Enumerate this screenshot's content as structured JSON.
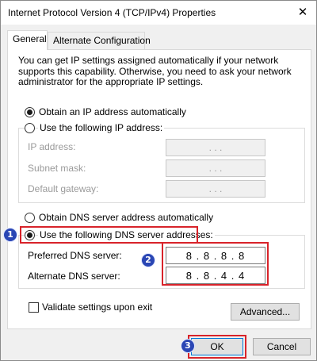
{
  "window": {
    "title": "Internet Protocol Version 4 (TCP/IPv4) Properties",
    "close_glyph": "✕"
  },
  "tabs": [
    {
      "label": "General"
    },
    {
      "label": "Alternate Configuration"
    }
  ],
  "info_text": "You can get IP settings assigned automatically if your network supports this capability. Otherwise, you need to ask your network administrator for the appropriate IP settings.",
  "ip_section": {
    "obtain_auto_label": "Obtain an IP address automatically",
    "use_following_label": "Use the following IP address:",
    "fields": [
      {
        "label": "IP address:",
        "value": ".    .    ."
      },
      {
        "label": "Subnet mask:",
        "value": ".    .    ."
      },
      {
        "label": "Default gateway:",
        "value": ".    .    ."
      }
    ]
  },
  "dns_section": {
    "obtain_auto_label": "Obtain DNS server address automatically",
    "use_following_label": "Use the following DNS server addresses:",
    "preferred_label": "Preferred DNS server:",
    "preferred_value": "8 . 8 . 8 . 8",
    "alternate_label": "Alternate DNS server:",
    "alternate_value": "8 . 8 . 4 . 4"
  },
  "validate_label": "Validate settings upon exit",
  "advanced_label": "Advanced...",
  "ok_label": "OK",
  "cancel_label": "Cancel",
  "badges": [
    "1",
    "2",
    "3"
  ],
  "colors": {
    "highlight": "#d8232a",
    "badge": "#2a46b4",
    "accent": "#0078d7"
  }
}
